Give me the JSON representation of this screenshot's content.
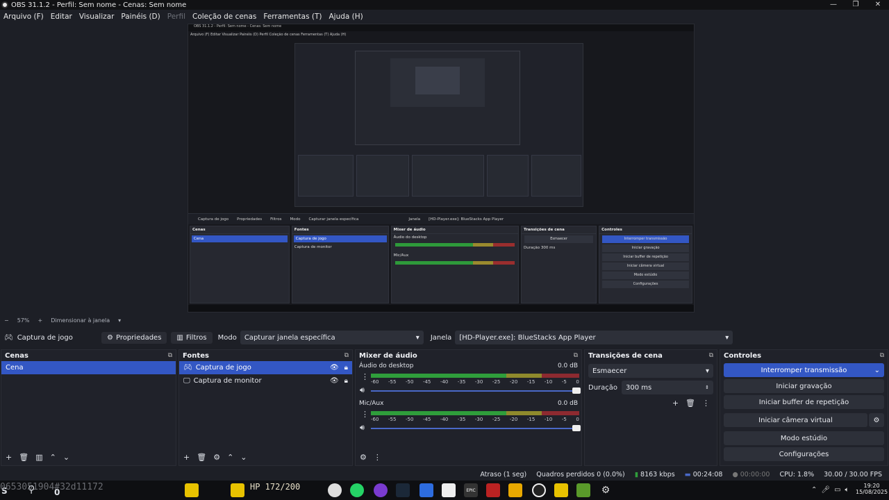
{
  "window": {
    "title": "OBS 31.1.2 - Perfil: Sem nome - Cenas: Sem nome"
  },
  "menu": {
    "items": [
      "Arquivo (F)",
      "Editar",
      "Visualizar",
      "Painéis (D)",
      "Perfil",
      "Coleção de cenas",
      "Ferramentas (T)",
      "Ajuda (H)"
    ]
  },
  "nested": {
    "title": "OBS 31.1.2 - Perfil: Sem nome - Cenas: Sem nome",
    "menu": "Arquivo (F)   Editar   Visualizar   Painéis (D)   Perfil   Coleção de cenas   Ferramentas (T)   Ajuda (H)",
    "source": "Captura de jogo",
    "props": "Propriedades",
    "filters": "Filtros",
    "mode": "Modo",
    "mode_value": "Capturar janela específica",
    "window_label": "Janela",
    "window_value": "[HD-Player.exe]: BlueStacks App Player",
    "zoom": "57%",
    "resize": "Dimensionar à janela",
    "scenes_h": "Cenas",
    "scene": "Cena",
    "sources_h": "Fontes",
    "src1": "Captura de jogo",
    "src2": "Captura de monitor",
    "mixer_h": "Mixer de áudio",
    "desktop": "Áudio do desktop",
    "mic": "Mic/Aux",
    "trans_h": "Transições de cena",
    "fade": "Esmaecer",
    "dur_label": "Duração",
    "dur": "300 ms",
    "controls_h": "Controles",
    "c1": "Interromper transmissão",
    "c2": "Iniciar gravação",
    "c3": "Iniciar buffer de repetição",
    "c4": "Iniciar câmera virtual",
    "c5": "Modo estúdio",
    "c6": "Configurações"
  },
  "preview_status": {
    "zoom": "57%",
    "resize": "Dimensionar à janela"
  },
  "toolbar": {
    "source": "Captura de jogo",
    "properties": "Propriedades",
    "filters": "Filtros",
    "mode_label": "Modo",
    "mode_value": "Capturar janela específica",
    "window_label": "Janela",
    "window_value": "[HD-Player.exe]: BlueStacks App Player"
  },
  "scenes": {
    "title": "Cenas",
    "items": [
      "Cena"
    ]
  },
  "sources": {
    "title": "Fontes",
    "items": [
      "Captura de jogo",
      "Captura de monitor"
    ]
  },
  "mixer": {
    "title": "Mixer de áudio",
    "channels": [
      {
        "name": "Áudio do desktop",
        "db": "0.0 dB"
      },
      {
        "name": "Mic/Aux",
        "db": "0.0 dB"
      }
    ],
    "ticks": [
      "-60",
      "-55",
      "-50",
      "-45",
      "-40",
      "-35",
      "-30",
      "-25",
      "-20",
      "-15",
      "-10",
      "-5",
      "0"
    ]
  },
  "transitions": {
    "title": "Transições de cena",
    "type": "Esmaecer",
    "duration_label": "Duração",
    "duration": "300 ms"
  },
  "controls": {
    "title": "Controles",
    "stop_stream": "Interromper transmissão",
    "start_recording": "Iniciar gravação",
    "replay_buffer": "Iniciar buffer de repetição",
    "virtual_camera": "Iniciar câmera virtual",
    "studio_mode": "Modo estúdio",
    "settings": "Configurações"
  },
  "status": {
    "delay": "Atraso (1 seg)",
    "dropped": "Quadros perdidos 0 (0.0%)",
    "bitrate": "8163 kbps",
    "stream_time": "00:24:08",
    "rec_time": "00:00:00",
    "cpu": "CPU: 1.8%",
    "fps": "30.00 / 30.00 FPS"
  },
  "taskbar": {
    "overlay_text": "0653051904#32d11172",
    "hp": "HP 172/200",
    "s": "S",
    "zero": "0",
    "time": "19:20",
    "date": "15/08/2025",
    "epic": "EPIC"
  },
  "colors": {
    "accent": "#3357c4",
    "bg": "#1d1f26",
    "dock": "#20222a",
    "meter_green": "#2f9e3b",
    "meter_yellow": "#8f8a2c",
    "meter_red": "#8d2a30"
  }
}
